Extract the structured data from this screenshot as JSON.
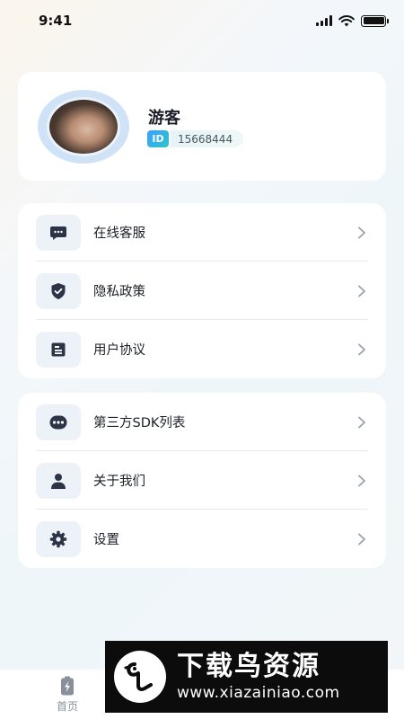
{
  "status_bar": {
    "time": "9:41"
  },
  "profile": {
    "name": "游客",
    "id_badge": "ID",
    "id_value": "15668444"
  },
  "menu_group_1": [
    {
      "label": "在线客服",
      "icon": "chat-icon"
    },
    {
      "label": "隐私政策",
      "icon": "shield-icon"
    },
    {
      "label": "用户协议",
      "icon": "document-icon"
    }
  ],
  "menu_group_2": [
    {
      "label": "第三方SDK列表",
      "icon": "more-dots-icon"
    },
    {
      "label": "关于我们",
      "icon": "person-icon"
    },
    {
      "label": "设置",
      "icon": "gear-icon"
    }
  ],
  "tab_bar": {
    "tabs": [
      {
        "label": "首页",
        "icon": "battery-bolt-icon",
        "active": false
      },
      {
        "label": "",
        "active": false
      },
      {
        "label": "",
        "active": true
      }
    ]
  },
  "watermark": {
    "title": "下载鸟资源",
    "url": "www.xiazainiao.com"
  },
  "colors": {
    "accent": "#21b36a",
    "icon_dark": "#2c3447",
    "icon_box": "#edf2f8",
    "chevron": "#9aa1ab",
    "id_badge_gradient_start": "#3aa0ff",
    "id_badge_gradient_end": "#2ec4c7"
  }
}
